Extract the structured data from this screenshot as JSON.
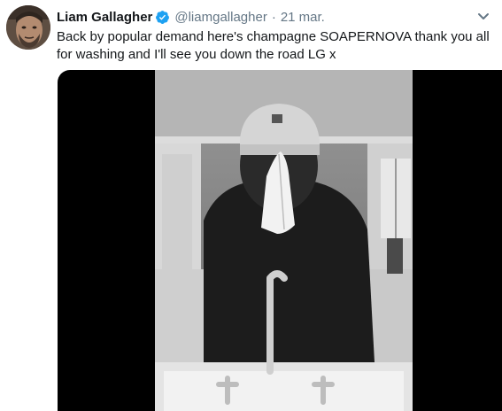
{
  "tweet": {
    "display_name": "Liam Gallagher",
    "handle": "@liamgallagher",
    "separator": "·",
    "timestamp": "21 mar.",
    "text": "Back by popular demand here's champagne SOAPERNOVA thank you all for washing and I'll see you down the road LG x",
    "verified_icon": "verified-badge-icon",
    "more_icon": "chevron-down-icon"
  },
  "colors": {
    "verified": "#1da1f2",
    "name": "#14171a",
    "secondary": "#657786",
    "media_background": "#000000"
  }
}
